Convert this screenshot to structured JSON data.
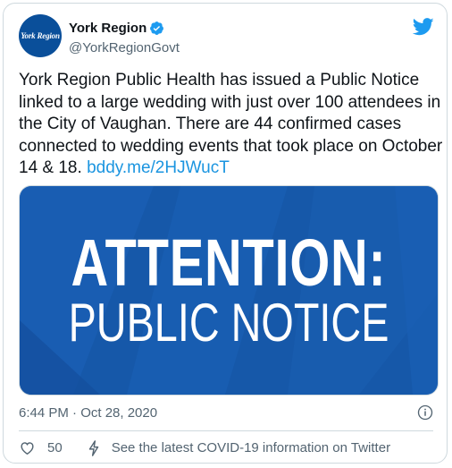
{
  "account": {
    "display_name": "York Region",
    "handle": "@YorkRegionGovt",
    "avatar_text": "York Region"
  },
  "tweet": {
    "text": "York Region Public Health has issued a Public Notice linked to a large wedding with just over 100 attendees in the City of Vaughan. There are 44 confirmed cases connected to wedding events that took place on October 14 & 18. ",
    "link": "bddy.me/2HJWucT",
    "timestamp": "6:44 PM · Oct 28, 2020"
  },
  "media": {
    "line1": "ATTENTION:",
    "line2": "PUBLIC NOTICE"
  },
  "actions": {
    "like_count": "50",
    "covid_info": "See the latest COVID-19 information on Twitter"
  },
  "colors": {
    "brand_blue": "#1d9bf0",
    "media_blue": "#1658a9",
    "avatar_blue": "#0a4f9a"
  },
  "icons": [
    "verified-badge-icon",
    "twitter-bird-icon",
    "info-icon",
    "heart-icon",
    "lightning-bolt-icon"
  ]
}
